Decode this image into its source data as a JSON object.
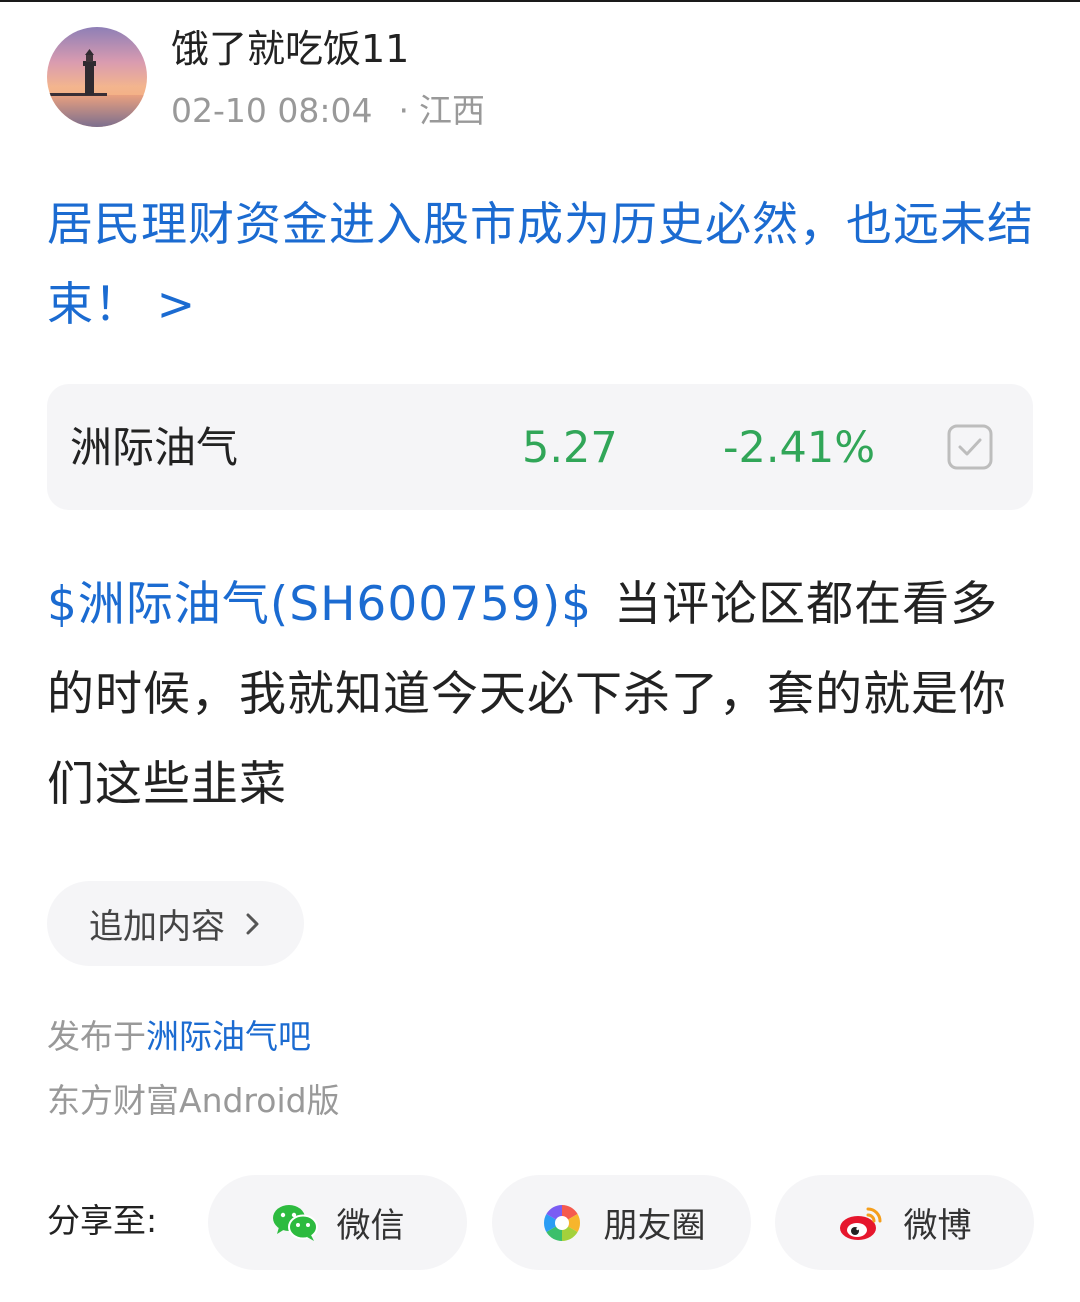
{
  "header": {
    "username": "饿了就吃饭11",
    "timestamp": "02-10 08:04",
    "separator": "·",
    "location": "江西",
    "avatar_icon": "lighthouse-sunset-avatar"
  },
  "headline": {
    "text": "居民理财资金进入股市成为历史必然，也远未结束！ >",
    "color": "#1b6bd1"
  },
  "stock_card": {
    "name": "洲际油气",
    "price": "5.27",
    "change": "-2.41%",
    "change_color": "#31a658",
    "action_icon": "check-square-icon"
  },
  "post": {
    "stock_tag": "$洲际油气(SH600759)$",
    "text": "当评论区都在看多的时候，我就知道今天必下杀了，套的就是你们这些韭菜"
  },
  "append": {
    "label": "追加内容",
    "icon": "chevron-right-icon"
  },
  "published": {
    "prefix": "发布于",
    "forum": "洲际油气吧"
  },
  "source": "东方财富Android版",
  "share": {
    "label": "分享至:",
    "buttons": [
      {
        "label": "微信",
        "icon": "wechat-icon"
      },
      {
        "label": "朋友圈",
        "icon": "moments-icon"
      },
      {
        "label": "微博",
        "icon": "weibo-icon"
      }
    ]
  }
}
